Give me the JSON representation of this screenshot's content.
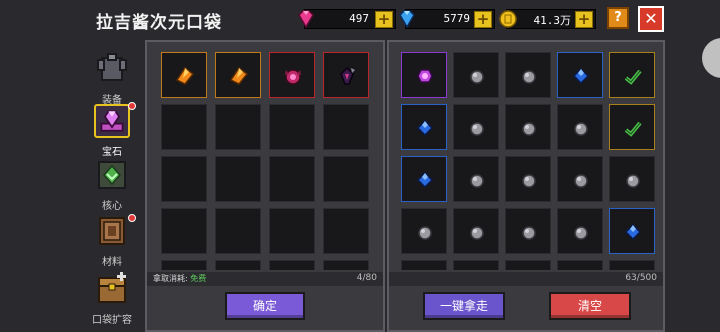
{
  "window": {
    "title": "拉吉酱次元口袋"
  },
  "currencies": [
    {
      "name": "gem-pink",
      "value": "497",
      "color": "#e83a8e"
    },
    {
      "name": "gem-blue",
      "value": "5779",
      "color": "#3aa0f0"
    },
    {
      "name": "gold-coin",
      "value": "41.3万",
      "color": "#f0c020"
    }
  ],
  "header_buttons": {
    "help": "?",
    "close": "✕"
  },
  "sidebar": {
    "items": [
      {
        "label": "装备",
        "icon": "armor-icon",
        "active": false,
        "badge": false
      },
      {
        "label": "宝石",
        "icon": "gem-icon",
        "active": true,
        "badge": true
      },
      {
        "label": "核心",
        "icon": "core-icon",
        "active": false,
        "badge": false
      },
      {
        "label": "材料",
        "icon": "material-icon",
        "active": false,
        "badge": true
      },
      {
        "label": "口袋扩容",
        "icon": "chest-icon",
        "active": false,
        "badge": false
      }
    ]
  },
  "left_panel": {
    "cost_label": "拿取消耗:",
    "cost_value": "免费",
    "count": "4/80",
    "confirm_label": "确定",
    "items": [
      {
        "icon": "orange-crystal-icon",
        "rarity": "orange"
      },
      {
        "icon": "orange-crystal-icon",
        "rarity": "orange"
      },
      {
        "icon": "demon-gem-icon",
        "rarity": "red"
      },
      {
        "icon": "dark-crystal-icon",
        "rarity": "red"
      }
    ]
  },
  "right_panel": {
    "count": "63/500",
    "take_all_label": "一键拿走",
    "clear_label": "清空",
    "rows": [
      [
        "purple-gem-icon",
        "stone-icon",
        "stone-icon",
        "blue-gem-icon",
        "green-check-icon"
      ],
      [
        "blue-gem-icon",
        "stone-icon",
        "stone-icon",
        "stone-icon",
        "green-check-icon"
      ],
      [
        "blue-gem-icon",
        "stone-icon",
        "stone-icon",
        "stone-icon",
        "stone-icon"
      ],
      [
        "stone-icon",
        "stone-icon",
        "stone-icon",
        "stone-icon",
        "blue-gem-icon"
      ]
    ],
    "rarity_rows": [
      [
        "purple",
        "",
        "",
        "blue",
        "gold"
      ],
      [
        "blue",
        "",
        "",
        "",
        "gold"
      ],
      [
        "blue",
        "",
        "",
        "",
        ""
      ],
      [
        "",
        "",
        "",
        "",
        "blue"
      ]
    ]
  }
}
